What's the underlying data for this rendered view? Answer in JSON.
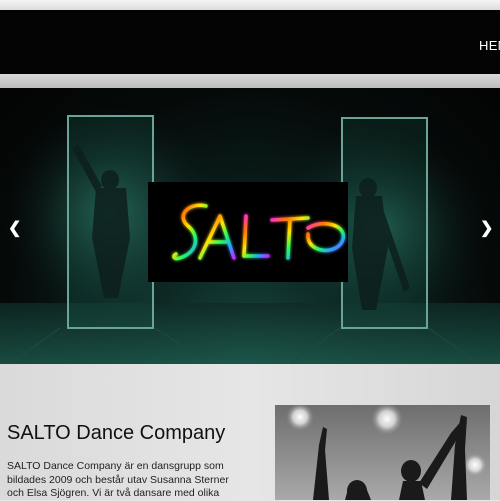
{
  "nav": {
    "item_home": "HEM"
  },
  "slider": {
    "prev_icon": "chevron-left-icon",
    "next_icon": "chevron-right-icon",
    "logo_text": "SALTO"
  },
  "content": {
    "title": "SALTO Dance Company",
    "paragraph": "SALTO Dance Company är en dansgrupp som bildades 2009 och består utav Susanna Sterner och Elsa Sjögren. Vi är två dansare med olika"
  },
  "colors": {
    "header_bg": "#040404",
    "stage_teal": "#1f8a74",
    "text": "#111111"
  }
}
